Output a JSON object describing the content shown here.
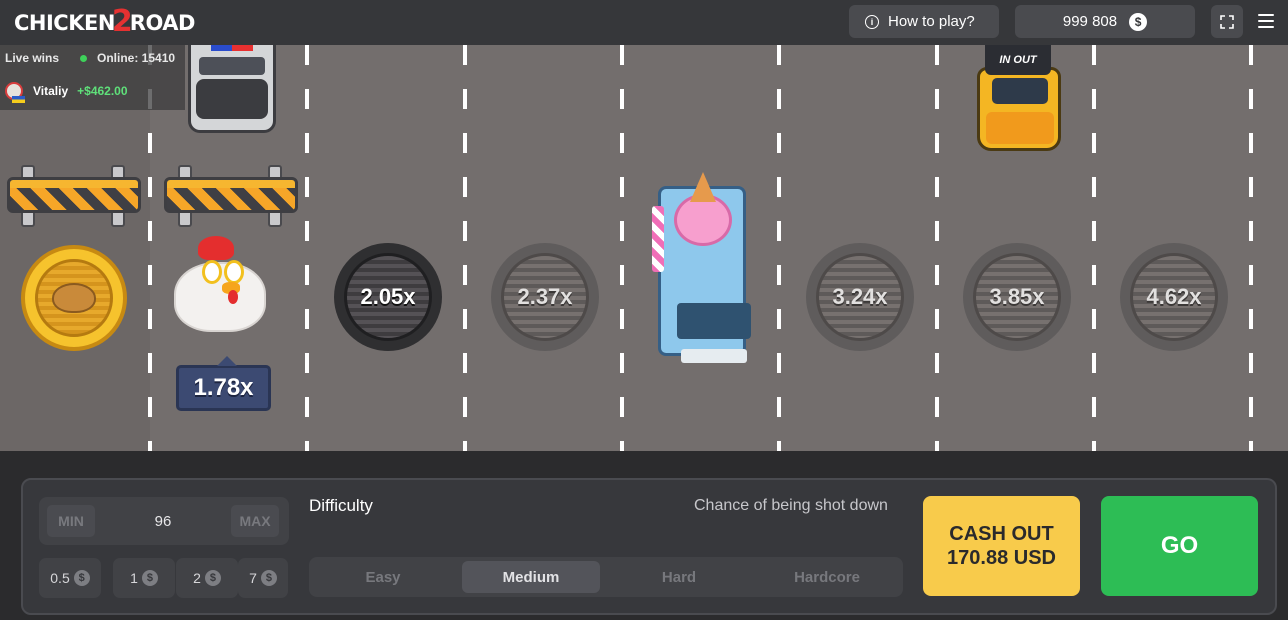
{
  "header": {
    "logo_left": "CHICKEN",
    "logo_number": "2",
    "logo_right": "ROAD",
    "how_to_play": "How to play?",
    "info_icon": "i",
    "balance": "999 808",
    "currency_icon": "$"
  },
  "live_wins": {
    "title": "Live wins",
    "online_label": "Online: 15410",
    "entry": {
      "user": "Vitaliy",
      "amount": "+$462.00"
    }
  },
  "road": {
    "current_multiplier": "1.78x",
    "multipliers": [
      "2.05x",
      "2.37x",
      "3.24x",
      "3.85x",
      "4.62x"
    ],
    "taxi_sign": "IN OUT"
  },
  "bet": {
    "min_label": "MIN",
    "max_label": "MAX",
    "value": "96",
    "chips": [
      "0.5",
      "1",
      "2",
      "7"
    ],
    "chip_icon": "$"
  },
  "difficulty": {
    "label": "Difficulty",
    "chance_label": "Chance of being shot down",
    "options": [
      "Easy",
      "Medium",
      "Hard",
      "Hardcore"
    ],
    "selected": "Medium"
  },
  "actions": {
    "cashout_line1": "CASH OUT",
    "cashout_line2": "170.88 USD",
    "go": "GO"
  },
  "colors": {
    "road": "#736e6d",
    "header": "#36373a",
    "cashout": "#f8cb4b",
    "go": "#2dbd55",
    "live_amount": "#5fe07a"
  }
}
